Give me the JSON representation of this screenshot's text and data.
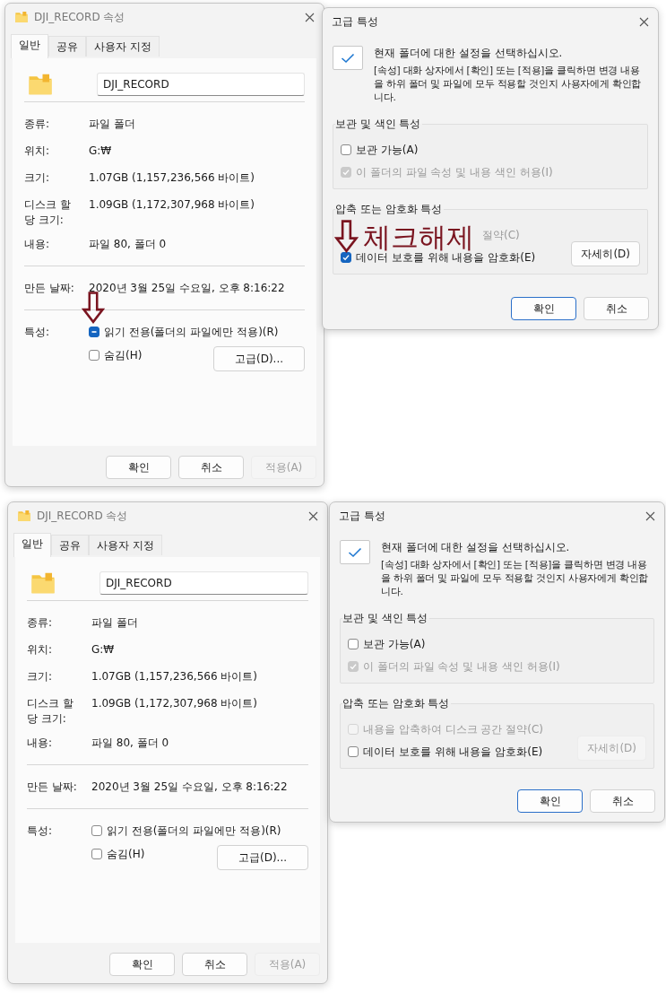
{
  "panels": [
    {
      "properties": {
        "title": "DJI_RECORD 속성",
        "tabs": [
          {
            "label": "일반",
            "selected": true
          },
          {
            "label": "공유",
            "selected": false
          },
          {
            "label": "사용자 지정",
            "selected": false
          }
        ],
        "name": "DJI_RECORD",
        "sections": [
          [
            {
              "label": "종류:",
              "value": "파일 폴더"
            },
            {
              "label": "위치:",
              "value": "G:₩"
            },
            {
              "label": "크기:",
              "value": "1.07GB (1,157,236,566 바이트)"
            },
            {
              "label": "디스크 할당 크기:",
              "value": "1.09GB (1,172,307,968 바이트)"
            },
            {
              "label": "내용:",
              "value": "파일 80, 폴더 0"
            }
          ],
          [
            {
              "label": "만든 날짜:",
              "value": "2020년 3월 25일 수요일, 오후 8:16:22"
            }
          ]
        ],
        "attributes_label": "특성:",
        "attributes": [
          {
            "label": "읽기 전용(폴더의 파일에만 적용)(R)",
            "checked": false,
            "indeterminate": true
          },
          {
            "label": "숨김(H)",
            "checked": false,
            "indeterminate": false
          }
        ],
        "advanced_button": "고급(D)...",
        "buttons": [
          {
            "label": "확인",
            "disabled": false
          },
          {
            "label": "취소",
            "disabled": false
          },
          {
            "label": "적용(A)",
            "disabled": true
          }
        ]
      },
      "advanced": {
        "title": "고급 특성",
        "heading": "현재 폴더에 대한 설정을 선택하십시오.",
        "description": "[속성] 대화 상자에서 [확인] 또는 [적용]을 클릭하면 변경 내용을 하위 폴더 및 파일에 모두 적용할 것인지 사용자에게 확인합니다.",
        "groups": [
          {
            "title": "보관 및 색인 특성",
            "options": [
              {
                "label": "보관 가능(A)",
                "checked": false,
                "disabled": false,
                "covered": false
              },
              {
                "label": "이 폴더의 파일 속성 및 내용 색인 허용(I)",
                "checked": true,
                "disabled": true,
                "covered": false
              }
            ]
          },
          {
            "title": "압축 또는 암호화 특성",
            "options": [
              {
                "label": "절약(C)",
                "covered": true
              },
              {
                "label": "데이터 보호를 위해 내용을 암호화(E)",
                "checked": true,
                "disabled": false,
                "covered": false
              }
            ],
            "details_button": {
              "label": "자세히(D)",
              "disabled": false
            }
          }
        ],
        "buttons": [
          {
            "label": "확인",
            "default": true
          },
          {
            "label": "취소",
            "default": false
          }
        ]
      },
      "annotation": {
        "text": "체크해제"
      }
    },
    {
      "properties": {
        "title": "DJI_RECORD 속성",
        "tabs": [
          {
            "label": "일반",
            "selected": true
          },
          {
            "label": "공유",
            "selected": false
          },
          {
            "label": "사용자 지정",
            "selected": false
          }
        ],
        "name": "DJI_RECORD",
        "sections": [
          [
            {
              "label": "종류:",
              "value": "파일 폴더"
            },
            {
              "label": "위치:",
              "value": "G:₩"
            },
            {
              "label": "크기:",
              "value": "1.07GB (1,157,236,566 바이트)"
            },
            {
              "label": "디스크 할당 크기:",
              "value": "1.09GB (1,172,307,968 바이트)"
            },
            {
              "label": "내용:",
              "value": "파일 80, 폴더 0"
            }
          ],
          [
            {
              "label": "만든 날짜:",
              "value": "2020년 3월 25일 수요일, 오후 8:16:22"
            }
          ]
        ],
        "attributes_label": "특성:",
        "attributes": [
          {
            "label": "읽기 전용(폴더의 파일에만 적용)(R)",
            "checked": false,
            "indeterminate": false
          },
          {
            "label": "숨김(H)",
            "checked": false,
            "indeterminate": false
          }
        ],
        "advanced_button": "고급(D)...",
        "buttons": [
          {
            "label": "확인",
            "disabled": false
          },
          {
            "label": "취소",
            "disabled": false
          },
          {
            "label": "적용(A)",
            "disabled": true
          }
        ]
      },
      "advanced": {
        "title": "고급 특성",
        "heading": "현재 폴더에 대한 설정을 선택하십시오.",
        "description": "[속성] 대화 상자에서 [확인] 또는 [적용]을 클릭하면 변경 내용을 하위 폴더 및 파일에 모두 적용할 것인지 사용자에게 확인합니다.",
        "groups": [
          {
            "title": "보관 및 색인 특성",
            "options": [
              {
                "label": "보관 가능(A)",
                "checked": false,
                "disabled": false,
                "covered": false
              },
              {
                "label": "이 폴더의 파일 속성 및 내용 색인 허용(I)",
                "checked": true,
                "disabled": true,
                "covered": false
              }
            ]
          },
          {
            "title": "압축 또는 암호화 특성",
            "options": [
              {
                "label": "내용을 압축하여 디스크 공간 절약(C)",
                "checked": false,
                "disabled": true,
                "covered": false
              },
              {
                "label": "데이터 보호를 위해 내용을 암호화(E)",
                "checked": false,
                "disabled": false,
                "covered": false
              }
            ],
            "details_button": {
              "label": "자세히(D)",
              "disabled": true
            }
          }
        ],
        "buttons": [
          {
            "label": "확인",
            "default": true
          },
          {
            "label": "취소",
            "default": false
          }
        ]
      }
    }
  ]
}
